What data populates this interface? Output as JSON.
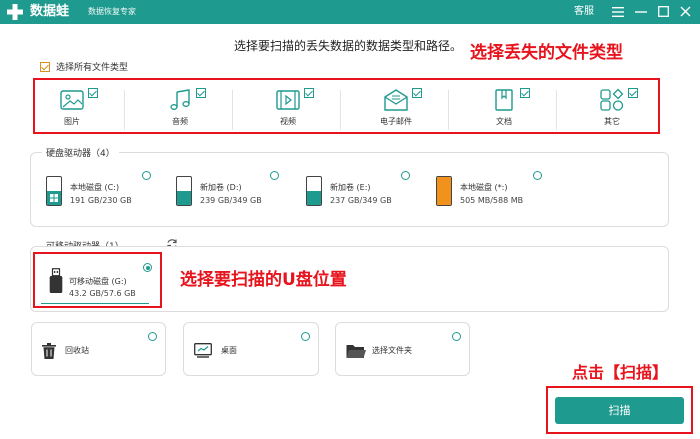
{
  "header": {
    "app_name": "数据蛙",
    "app_subtitle": "数据恢复专家",
    "customer_service": "客服",
    "menu_icon": "menu-icon",
    "minimize_icon": "minimize-icon",
    "close_icon": "close-icon"
  },
  "instruction": "选择要扫描的丢失数据的数据类型和路径。",
  "annotations": {
    "file_types": "选择丢失的文件类型",
    "usb_location": "选择要扫描的U盘位置",
    "scan_hint": "点击【扫描】"
  },
  "select_all": {
    "label": "选择所有文件类型",
    "checked": true
  },
  "file_types": [
    {
      "label": "图片",
      "icon": "image-icon",
      "checked": true
    },
    {
      "label": "音频",
      "icon": "music-icon",
      "checked": true
    },
    {
      "label": "视频",
      "icon": "video-icon",
      "checked": true
    },
    {
      "label": "电子邮件",
      "icon": "email-icon",
      "checked": true
    },
    {
      "label": "文档",
      "icon": "document-icon",
      "checked": true
    },
    {
      "label": "其它",
      "icon": "other-icon",
      "checked": true
    }
  ],
  "hard_drives": {
    "title": "硬盘驱动器（4）",
    "drives": [
      {
        "name": "本地磁盘 (C:)",
        "size": "191 GB/230 GB",
        "icon": "windows-drive-icon",
        "used_fraction": 0.83,
        "color": "#1f9a8e"
      },
      {
        "name": "新加卷 (D:)",
        "size": "239 GB/349 GB",
        "icon": "drive-icon",
        "used_fraction": 0.68,
        "color": "#1f9a8e"
      },
      {
        "name": "新加卷 (E:)",
        "size": "237 GB/349 GB",
        "icon": "drive-icon",
        "used_fraction": 0.68,
        "color": "#1f9a8e"
      },
      {
        "name": "本地磁盘 (*:)",
        "size": "505 MB/588 MB",
        "icon": "drive-icon",
        "used_fraction": 0.86,
        "color": "#f0921c"
      }
    ]
  },
  "removable": {
    "title": "可移动驱动器（1）",
    "refresh_icon": "refresh-icon",
    "drive": {
      "name": "可移动磁盘 (G:)",
      "size": "43.2 GB/57.6 GB",
      "icon": "usb-icon",
      "used_fraction": 0.75,
      "selected": true
    }
  },
  "locations": [
    {
      "label": "回收站",
      "icon": "trash-icon"
    },
    {
      "label": "桌面",
      "icon": "desktop-icon"
    },
    {
      "label": "选择文件夹",
      "icon": "folder-icon"
    }
  ],
  "scan_button": "扫描",
  "colors": {
    "accent": "#1f9a8e",
    "annotation": "#e8141d",
    "orange": "#f0921c"
  }
}
